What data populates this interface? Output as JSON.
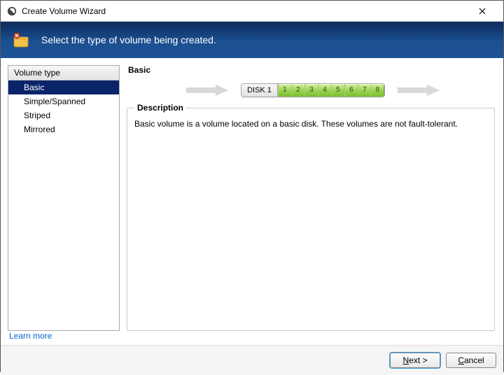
{
  "window": {
    "title": "Create Volume Wizard"
  },
  "banner": {
    "text": "Select the type of volume being created."
  },
  "sidebar": {
    "header": "Volume type",
    "items": [
      {
        "label": "Basic",
        "selected": true
      },
      {
        "label": "Simple/Spanned",
        "selected": false
      },
      {
        "label": "Striped",
        "selected": false
      },
      {
        "label": "Mirrored",
        "selected": false
      }
    ]
  },
  "main": {
    "title": "Basic",
    "disk": {
      "label": "DISK 1",
      "segments": [
        "1",
        "2",
        "3",
        "4",
        "5",
        "6",
        "7",
        "8"
      ]
    },
    "description": {
      "legend": "Description",
      "text": "Basic volume is a volume located on a basic disk. These volumes are not fault-tolerant."
    }
  },
  "links": {
    "learn_more": "Learn more"
  },
  "buttons": {
    "next_prefix": "N",
    "next_rest": "ext >",
    "cancel_prefix": "C",
    "cancel_rest": "ancel"
  }
}
